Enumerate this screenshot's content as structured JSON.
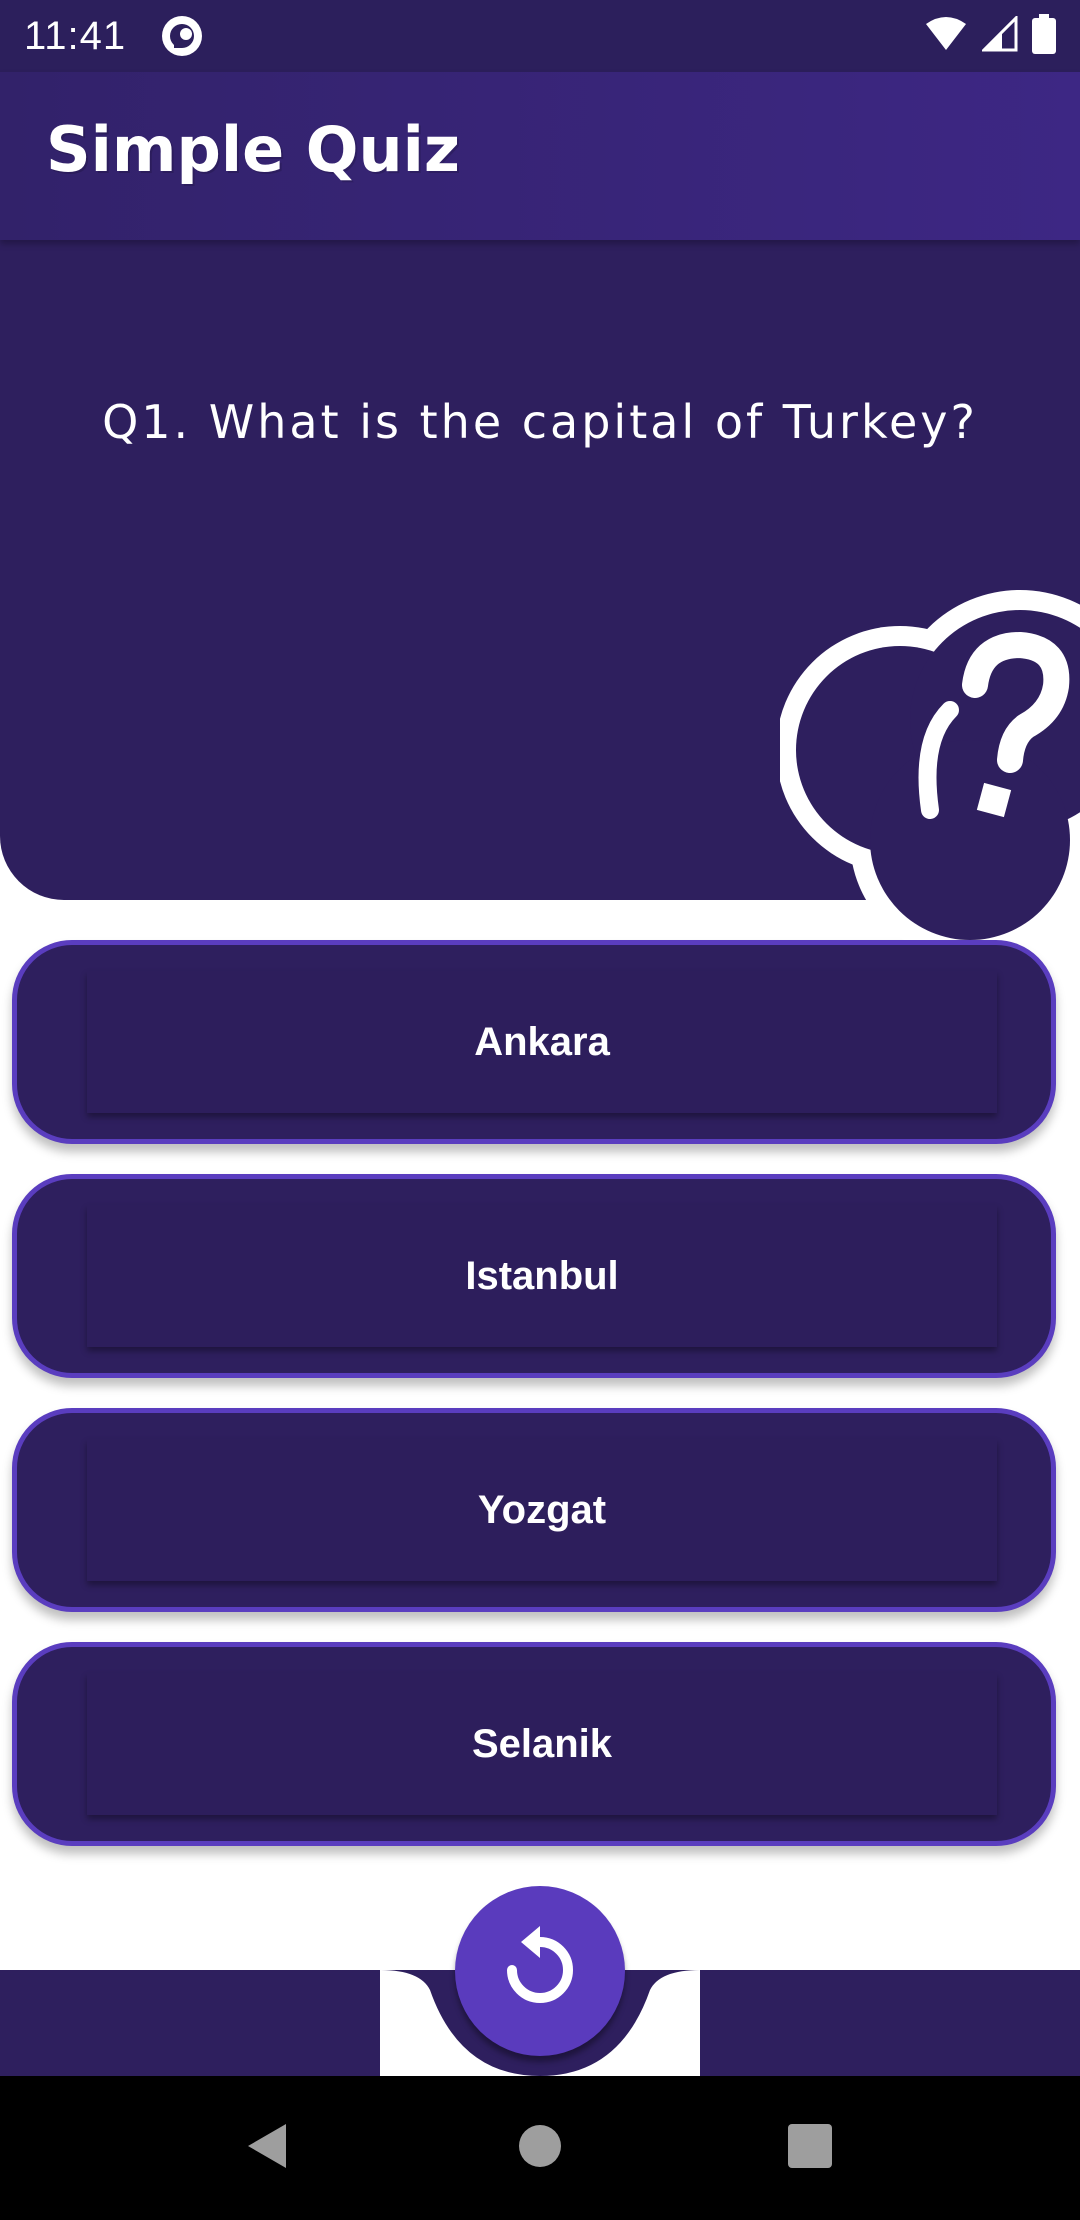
{
  "status_bar": {
    "time": "11:41",
    "icons": [
      "app-notification-icon",
      "wifi-icon",
      "cellular-signal-icon",
      "battery-icon"
    ]
  },
  "app_bar": {
    "title": "Simple Quiz"
  },
  "question": {
    "text": "Q1. What is the capital of Turkey?",
    "illustration_icon": "thinking-question-cloud-icon"
  },
  "answers": [
    {
      "label": "Ankara"
    },
    {
      "label": "Istanbul"
    },
    {
      "label": "Yozgat"
    },
    {
      "label": "Selanik"
    }
  ],
  "fab": {
    "icon": "restart-icon"
  },
  "navigation_bar": {
    "icons": [
      "back-icon",
      "home-icon",
      "recents-icon"
    ]
  },
  "colors": {
    "primary_dark": "#2e1f5e",
    "app_bar": "#3a2578",
    "accent": "#5a3bbd",
    "button_border": "#5a3dbf",
    "text_on_dark": "#ffffff"
  }
}
